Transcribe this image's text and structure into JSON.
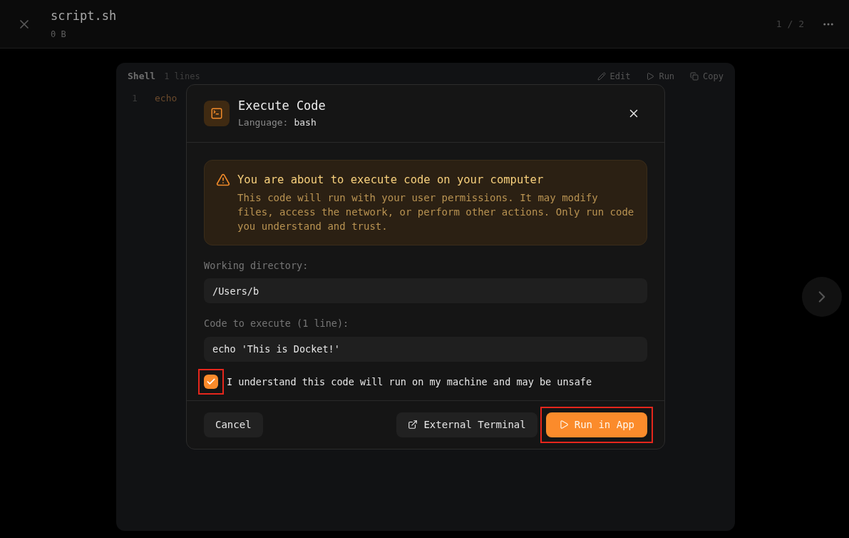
{
  "top_bar": {
    "file_name": "script.sh",
    "file_size": "0 B",
    "pager": "1 / 2"
  },
  "code_panel": {
    "language": "Shell",
    "line_count": "1 lines",
    "actions": [
      {
        "kind": "edit",
        "label": "Edit"
      },
      {
        "kind": "run",
        "label": "Run"
      },
      {
        "kind": "copy",
        "label": "Copy"
      }
    ],
    "lines": [
      {
        "number": "1",
        "code": "echo"
      }
    ]
  },
  "dialog": {
    "title": "Execute Code",
    "language_label": "Language:",
    "language": "bash",
    "warning": {
      "title": "You are about to execute code on your computer",
      "body": "This code will run with your user permissions. It may modify files, access the network, or perform other actions. Only run code you understand and trust."
    },
    "fields": [
      {
        "label": "Working directory:",
        "value": "/Users/b"
      },
      {
        "label": "Code to execute (1 line):",
        "value": "echo 'This is Docket!'"
      }
    ],
    "consent": {
      "label": "I understand this code will run on my machine and may be unsafe",
      "checked": true,
      "highlighted": true
    },
    "buttons": [
      {
        "kind": "secondary",
        "label": "Cancel",
        "highlighted": false
      },
      {
        "kind": "external",
        "label": "External Terminal",
        "highlighted": false
      },
      {
        "kind": "primary",
        "label": "Run in App",
        "highlighted": true
      }
    ]
  }
}
